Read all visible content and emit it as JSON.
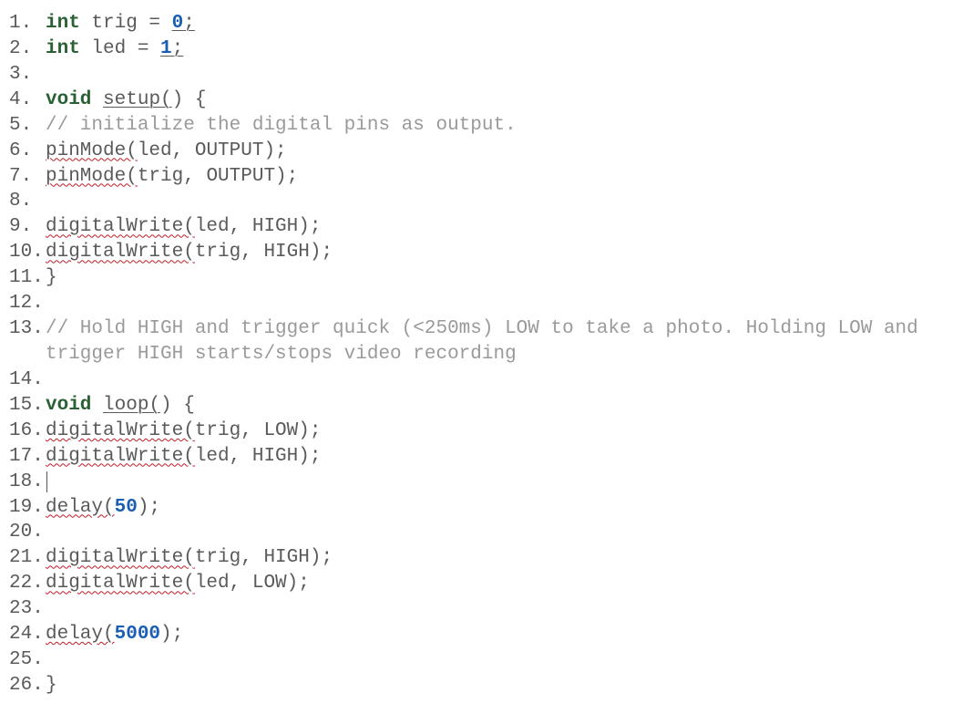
{
  "code": {
    "lines": [
      {
        "n": "1.",
        "tokens": [
          {
            "t": "int",
            "c": "kw-type"
          },
          {
            "t": " trig = "
          },
          {
            "t": "0",
            "c": "num und-num"
          },
          {
            "t": ";",
            "c": "und"
          }
        ]
      },
      {
        "n": "2.",
        "tokens": [
          {
            "t": "int",
            "c": "kw-type"
          },
          {
            "t": " led = "
          },
          {
            "t": "1",
            "c": "num und-num"
          },
          {
            "t": ";",
            "c": "und"
          }
        ]
      },
      {
        "n": "3.",
        "tokens": []
      },
      {
        "n": "4.",
        "tokens": [
          {
            "t": "void",
            "c": "kw-void"
          },
          {
            "t": " "
          },
          {
            "t": "setup(",
            "c": "und"
          },
          {
            "t": ") {"
          }
        ]
      },
      {
        "n": "5.",
        "tokens": [
          {
            "t": "// initialize the digital pins as output.",
            "c": "comment"
          }
        ]
      },
      {
        "n": "6.",
        "tokens": [
          {
            "t": "pinMode(",
            "c": "fn"
          },
          {
            "t": "led, OUTPUT);"
          }
        ]
      },
      {
        "n": "7.",
        "tokens": [
          {
            "t": "pinMode(",
            "c": "fn"
          },
          {
            "t": "trig, OUTPUT);"
          }
        ]
      },
      {
        "n": "8.",
        "tokens": []
      },
      {
        "n": "9.",
        "tokens": [
          {
            "t": "digitalWrite(",
            "c": "fn"
          },
          {
            "t": "led, HIGH);"
          }
        ]
      },
      {
        "n": "10.",
        "tokens": [
          {
            "t": "digitalWrite(",
            "c": "fn"
          },
          {
            "t": "trig, HIGH);"
          }
        ]
      },
      {
        "n": "11.",
        "tokens": [
          {
            "t": "}"
          }
        ]
      },
      {
        "n": "12.",
        "tokens": []
      },
      {
        "n": "13.",
        "tokens": [
          {
            "t": "// Hold HIGH and trigger quick (<250ms) LOW to take a photo. Holding LOW and trigger HIGH starts/stops video recording",
            "c": "comment"
          }
        ]
      },
      {
        "n": "14.",
        "tokens": []
      },
      {
        "n": "15.",
        "tokens": [
          {
            "t": "void",
            "c": "kw-void"
          },
          {
            "t": " "
          },
          {
            "t": "loop(",
            "c": "und"
          },
          {
            "t": ") {"
          }
        ]
      },
      {
        "n": "16.",
        "tokens": [
          {
            "t": "digitalWrite(",
            "c": "fn"
          },
          {
            "t": "trig, LOW);"
          }
        ]
      },
      {
        "n": "17.",
        "tokens": [
          {
            "t": "digitalWrite(",
            "c": "fn"
          },
          {
            "t": "led, HIGH);"
          }
        ]
      },
      {
        "n": "18.",
        "tokens": [],
        "cursor": true
      },
      {
        "n": "19.",
        "tokens": [
          {
            "t": "delay(",
            "c": "fn"
          },
          {
            "t": "50",
            "c": "num"
          },
          {
            "t": ");"
          }
        ]
      },
      {
        "n": "20.",
        "tokens": []
      },
      {
        "n": "21.",
        "tokens": [
          {
            "t": "digitalWrite(",
            "c": "fn"
          },
          {
            "t": "trig, HIGH);"
          }
        ]
      },
      {
        "n": "22.",
        "tokens": [
          {
            "t": "digitalWrite(",
            "c": "fn"
          },
          {
            "t": "led, LOW);"
          }
        ]
      },
      {
        "n": "23.",
        "tokens": []
      },
      {
        "n": "24.",
        "tokens": [
          {
            "t": "delay(",
            "c": "fn"
          },
          {
            "t": "5000",
            "c": "num"
          },
          {
            "t": ");"
          }
        ]
      },
      {
        "n": "25.",
        "tokens": []
      },
      {
        "n": "26.",
        "tokens": [
          {
            "t": "}"
          }
        ]
      }
    ]
  }
}
